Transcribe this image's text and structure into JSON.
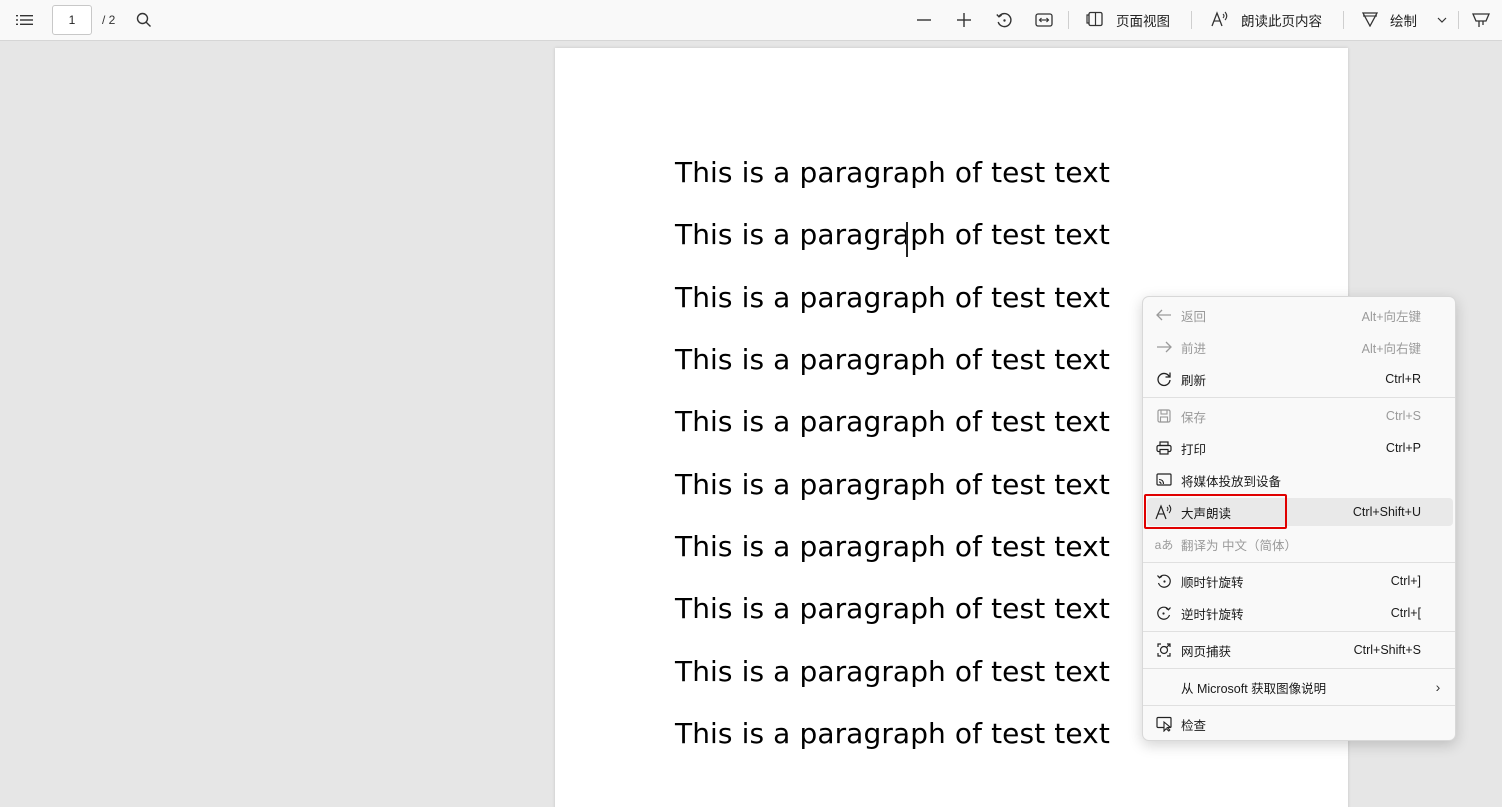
{
  "toolbar": {
    "page_current": "1",
    "page_total": "/ 2",
    "page_view_label": "页面视图",
    "read_aloud_label": "朗读此页内容",
    "draw_label": "绘制"
  },
  "document": {
    "paragraphs": [
      "This is a paragraph of test text",
      "This is a paragraph of test text",
      "This is a paragraph of test text",
      "This is a paragraph of test text",
      "This is a paragraph of test text",
      "This is a paragraph of test text",
      "This is a paragraph of test text",
      "This is a paragraph of test text",
      "This is a paragraph of test text",
      "This is a paragraph of test text"
    ]
  },
  "context_menu": {
    "back": {
      "label": "返回",
      "shortcut": "Alt+向左键"
    },
    "forward": {
      "label": "前进",
      "shortcut": "Alt+向右键"
    },
    "refresh": {
      "label": "刷新",
      "shortcut": "Ctrl+R"
    },
    "save": {
      "label": "保存",
      "shortcut": "Ctrl+S"
    },
    "print": {
      "label": "打印",
      "shortcut": "Ctrl+P"
    },
    "cast": {
      "label": "将媒体投放到设备"
    },
    "read_aloud": {
      "label": "大声朗读",
      "shortcut": "Ctrl+Shift+U"
    },
    "translate": {
      "label": "翻译为 中文（简体）"
    },
    "rotate_cw": {
      "label": "顺时针旋转",
      "shortcut": "Ctrl+]"
    },
    "rotate_ccw": {
      "label": "逆时针旋转",
      "shortcut": "Ctrl+["
    },
    "web_capture": {
      "label": "网页捕获",
      "shortcut": "Ctrl+Shift+S"
    },
    "image_desc": {
      "label": "从 Microsoft 获取图像说明"
    },
    "inspect": {
      "label": "检查"
    }
  },
  "colors": {
    "highlight_box": "#e00000",
    "menu_background": "#f9f9f9",
    "viewer_background": "#e6e6e6"
  }
}
